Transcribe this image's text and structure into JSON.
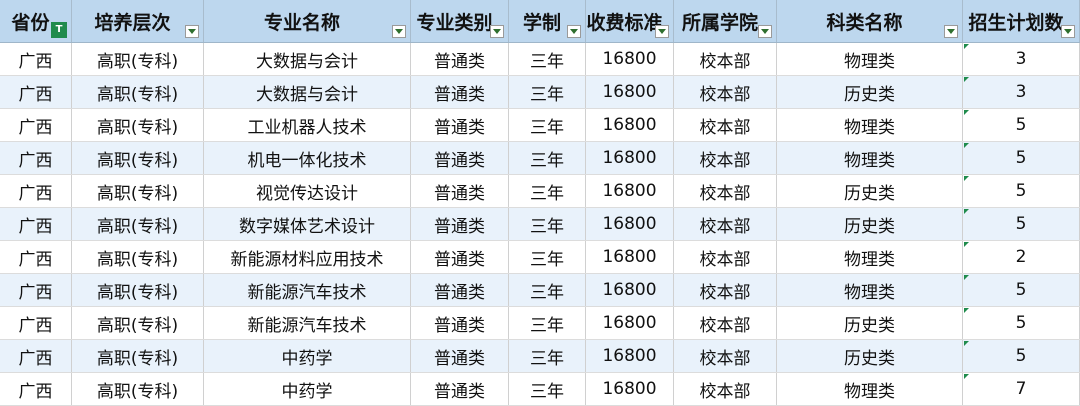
{
  "headers": [
    "省份",
    "培养层次",
    "专业名称",
    "专业类别",
    "学制",
    "收费标准",
    "所属学院",
    "科类名称",
    "招生计划数"
  ],
  "rows": [
    [
      "广西",
      "高职(专科)",
      "大数据与会计",
      "普通类",
      "三年",
      "16800",
      "校本部",
      "物理类",
      "3"
    ],
    [
      "广西",
      "高职(专科)",
      "大数据与会计",
      "普通类",
      "三年",
      "16800",
      "校本部",
      "历史类",
      "3"
    ],
    [
      "广西",
      "高职(专科)",
      "工业机器人技术",
      "普通类",
      "三年",
      "16800",
      "校本部",
      "物理类",
      "5"
    ],
    [
      "广西",
      "高职(专科)",
      "机电一体化技术",
      "普通类",
      "三年",
      "16800",
      "校本部",
      "物理类",
      "5"
    ],
    [
      "广西",
      "高职(专科)",
      "视觉传达设计",
      "普通类",
      "三年",
      "16800",
      "校本部",
      "历史类",
      "5"
    ],
    [
      "广西",
      "高职(专科)",
      "数字媒体艺术设计",
      "普通类",
      "三年",
      "16800",
      "校本部",
      "历史类",
      "5"
    ],
    [
      "广西",
      "高职(专科)",
      "新能源材料应用技术",
      "普通类",
      "三年",
      "16800",
      "校本部",
      "物理类",
      "2"
    ],
    [
      "广西",
      "高职(专科)",
      "新能源汽车技术",
      "普通类",
      "三年",
      "16800",
      "校本部",
      "物理类",
      "5"
    ],
    [
      "广西",
      "高职(专科)",
      "新能源汽车技术",
      "普通类",
      "三年",
      "16800",
      "校本部",
      "历史类",
      "5"
    ],
    [
      "广西",
      "高职(专科)",
      "中药学",
      "普通类",
      "三年",
      "16800",
      "校本部",
      "历史类",
      "5"
    ],
    [
      "广西",
      "高职(专科)",
      "中药学",
      "普通类",
      "三年",
      "16800",
      "校本部",
      "物理类",
      "7"
    ]
  ],
  "colors": {
    "header_bg": "#bdd7ee",
    "alt_row_bg": "#e9f2fb",
    "filter_active": "#1f8b4c"
  }
}
